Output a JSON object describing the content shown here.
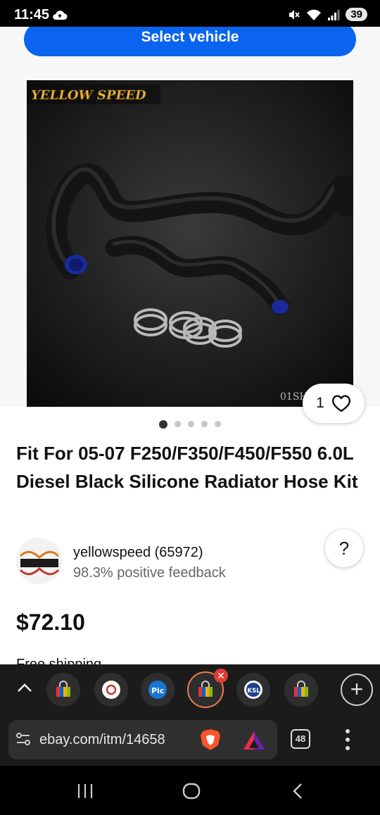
{
  "status_bar": {
    "time": "11:45",
    "battery": "39"
  },
  "header": {
    "select_vehicle_label": "Select vehicle"
  },
  "gallery": {
    "watermark_brand": "YELLOW SPEED",
    "image_code": "01SH",
    "like_count": "1",
    "page_dots": 5,
    "active_dot": 0
  },
  "listing": {
    "title": "Fit For 05-07 F250/F350/F450/F550 6.0L Diesel Black Silicone Radiator Hose Kit",
    "seller_name": "yellowspeed (65972)",
    "seller_feedback": "98.3% positive feedback",
    "help_label": "?",
    "price": "$72.10",
    "shipping": "Free shipping"
  },
  "browser": {
    "url": "ebay.com/itm/14658",
    "tab_count": "48",
    "tabs": [
      {
        "name": "ebay-tab",
        "active": false
      },
      {
        "name": "tab-2",
        "active": false
      },
      {
        "name": "pic-tab",
        "active": false
      },
      {
        "name": "ebay-active-tab",
        "active": true
      },
      {
        "name": "ksl-tab",
        "active": false
      },
      {
        "name": "ebay-tab-2",
        "active": false
      }
    ]
  },
  "colors": {
    "accent_blue": "#0a64ef",
    "active_tab_ring": "#f07a4a",
    "brave_orange": "#fb542b"
  }
}
